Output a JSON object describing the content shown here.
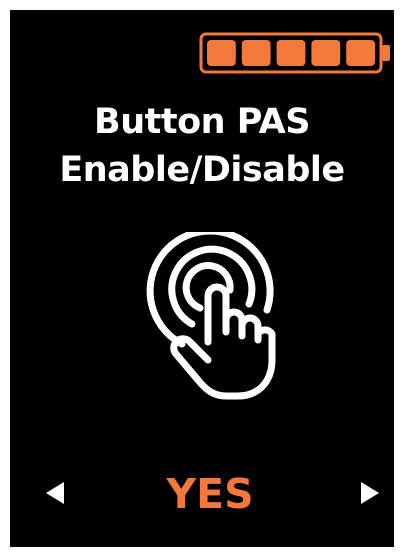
{
  "title": {
    "line1": "Button PAS",
    "line2": "Enable/Disable"
  },
  "battery": {
    "icon": "battery-icon",
    "level": 1.0,
    "segments_total": 5,
    "segments_filled": 5,
    "color": "#f2793a"
  },
  "icon": {
    "name": "touch-gesture-icon",
    "color": "#ffffff"
  },
  "selector": {
    "value": "YES",
    "value_color": "#f2793a",
    "left_arrow": "left-arrow-icon",
    "right_arrow": "right-arrow-icon",
    "arrow_color": "#ffffff"
  },
  "colors": {
    "background": "#000000",
    "text": "#ffffff",
    "accent": "#f2793a"
  }
}
